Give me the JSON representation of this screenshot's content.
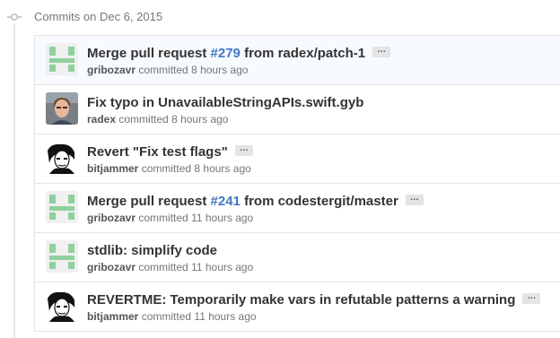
{
  "day_header": "Commits on Dec 6, 2015",
  "commits": [
    {
      "title_pre": "Merge pull request ",
      "pr": "#279",
      "title_post": " from radex/patch-1",
      "ellipsis": "…",
      "author": "gribozavr",
      "verb": "committed",
      "time": "8 hours ago",
      "avatar": "identicon-green"
    },
    {
      "title_pre": "Fix typo in UnavailableStringAPIs.swift.gyb",
      "author": "radex",
      "verb": "committed",
      "time": "8 hours ago",
      "avatar": "photo-portrait"
    },
    {
      "title_pre": "Revert \"Fix test flags\"",
      "ellipsis": "…",
      "author": "bitjammer",
      "verb": "committed",
      "time": "8 hours ago",
      "avatar": "bw-portrait"
    },
    {
      "title_pre": "Merge pull request ",
      "pr": "#241",
      "title_post": " from codestergit/master",
      "ellipsis": "…",
      "author": "gribozavr",
      "verb": "committed",
      "time": "11 hours ago",
      "avatar": "identicon-green"
    },
    {
      "title_pre": "stdlib: simplify code",
      "author": "gribozavr",
      "verb": "committed",
      "time": "11 hours ago",
      "avatar": "identicon-green"
    },
    {
      "title_pre": "REVERTME: Temporarily make vars in refutable patterns a warning",
      "ellipsis": "…",
      "author": "bitjammer",
      "verb": "committed",
      "time": "11 hours ago",
      "avatar": "bw-portrait"
    }
  ],
  "colors": {
    "link": "#4078c0",
    "identicon": "#8fd19e",
    "muted": "#767676"
  }
}
